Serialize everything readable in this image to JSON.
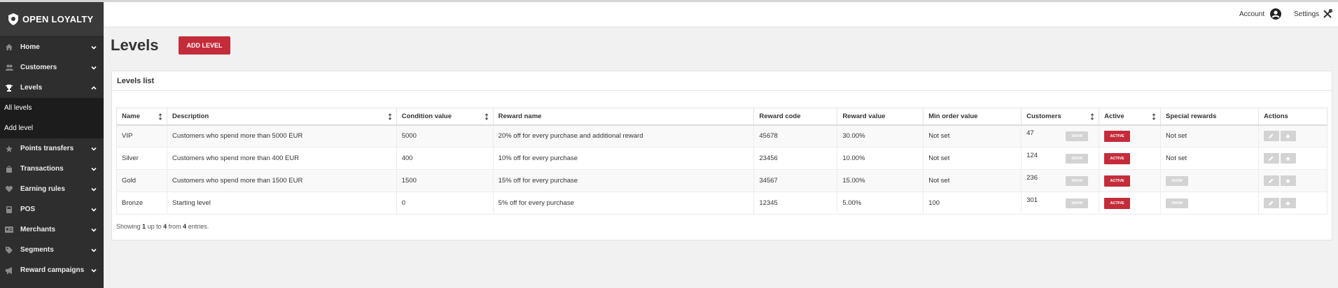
{
  "app": {
    "logo_text": "OPEN LOYALTY"
  },
  "sidebar": {
    "items": [
      {
        "label": "Home",
        "icon": "home-icon",
        "expanded": false
      },
      {
        "label": "Customers",
        "icon": "users-icon",
        "expanded": false
      },
      {
        "label": "Levels",
        "icon": "trophy-icon",
        "expanded": true
      },
      {
        "label": "Points transfers",
        "icon": "star-icon",
        "expanded": false
      },
      {
        "label": "Transactions",
        "icon": "bag-icon",
        "expanded": false
      },
      {
        "label": "Earning rules",
        "icon": "heart-icon",
        "expanded": false
      },
      {
        "label": "POS",
        "icon": "pos-icon",
        "expanded": false
      },
      {
        "label": "Merchants",
        "icon": "id-card-icon",
        "expanded": false
      },
      {
        "label": "Segments",
        "icon": "tag-icon",
        "expanded": false
      },
      {
        "label": "Reward campaigns",
        "icon": "megaphone-icon",
        "expanded": false
      }
    ],
    "sub_items": [
      "All levels",
      "Add level"
    ]
  },
  "topbar": {
    "account_label": "Account",
    "settings_label": "Settings"
  },
  "page": {
    "title": "Levels",
    "add_button": "ADD LEVEL"
  },
  "panel": {
    "title": "Levels list"
  },
  "table": {
    "columns": [
      "Name",
      "Description",
      "Condition value",
      "Reward name",
      "Reward code",
      "Reward value",
      "Min order value",
      "Customers",
      "Active",
      "Special rewards",
      "Actions"
    ],
    "rows": [
      {
        "name": "VIP",
        "description": "Customers who spend more than 5000 EUR",
        "condition_value": "5000",
        "reward_name": "20% off for every purchase and additional reward",
        "reward_code": "45678",
        "reward_value": "30.00%",
        "min_order_value": "Not set",
        "customers": "47",
        "active": "ACTIVE",
        "special_rewards": "Not set"
      },
      {
        "name": "Silver",
        "description": "Customers who spend more than 400 EUR",
        "condition_value": "400",
        "reward_name": "10% off for every purchase",
        "reward_code": "23456",
        "reward_value": "10.00%",
        "min_order_value": "Not set",
        "customers": "124",
        "active": "ACTIVE",
        "special_rewards": "Not set"
      },
      {
        "name": "Gold",
        "description": "Customers who spend more than 1500 EUR",
        "condition_value": "1500",
        "reward_name": "15% off for every purchase",
        "reward_code": "34567",
        "reward_value": "15.00%",
        "min_order_value": "Not set",
        "customers": "236",
        "active": "ACTIVE",
        "special_rewards": ""
      },
      {
        "name": "Bronze",
        "description": "Starting level",
        "condition_value": "0",
        "reward_name": "5% off for every purchase",
        "reward_code": "12345",
        "reward_value": "5.00%",
        "min_order_value": "100",
        "customers": "301",
        "active": "ACTIVE",
        "special_rewards": ""
      }
    ],
    "show_label": "SHOW"
  },
  "info": {
    "prefix": "Showing",
    "from": "1",
    "mid1": "up to",
    "to": "4",
    "mid2": "from",
    "total": "4",
    "suffix": "entries."
  },
  "colors": {
    "accent": "#c42c3a",
    "sidebar_bg": "#2e2e2e",
    "submenu_bg": "#1c1c1c"
  }
}
